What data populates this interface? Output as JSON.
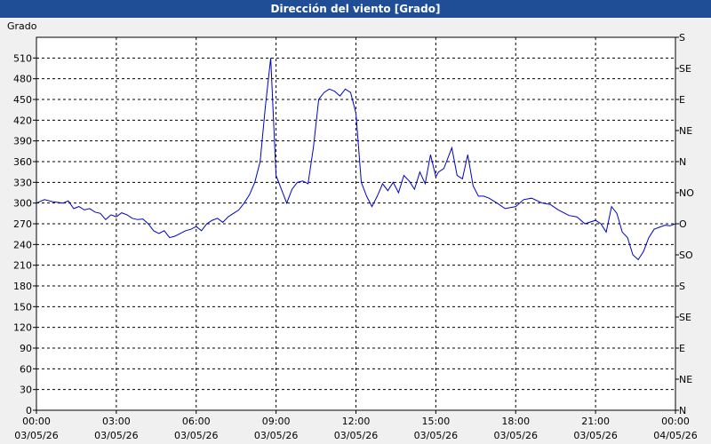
{
  "window": {
    "title": "Dirección del viento [Grado]"
  },
  "chart_data": {
    "type": "line",
    "title": "Dirección del viento [Grado]",
    "ylabel": "Grado",
    "ylim": [
      0,
      540
    ],
    "y_ticks": [
      0,
      30,
      60,
      90,
      120,
      150,
      180,
      210,
      240,
      270,
      300,
      330,
      360,
      390,
      420,
      450,
      480,
      510
    ],
    "right_axis_labels": [
      {
        "value": 0,
        "label": "N"
      },
      {
        "value": 45,
        "label": "NE"
      },
      {
        "value": 90,
        "label": "E"
      },
      {
        "value": 135,
        "label": "SE"
      },
      {
        "value": 180,
        "label": "S"
      },
      {
        "value": 225,
        "label": "SO"
      },
      {
        "value": 270,
        "label": "O"
      },
      {
        "value": 315,
        "label": "NO"
      },
      {
        "value": 360,
        "label": "N"
      },
      {
        "value": 405,
        "label": "NE"
      },
      {
        "value": 450,
        "label": "E"
      },
      {
        "value": 495,
        "label": "SE"
      },
      {
        "value": 540,
        "label": "S"
      }
    ],
    "xlim_hours": [
      0,
      24
    ],
    "x_ticks": [
      {
        "hour": 0,
        "time": "00:00",
        "date": "03/05/26"
      },
      {
        "hour": 3,
        "time": "03:00",
        "date": "03/05/26"
      },
      {
        "hour": 6,
        "time": "06:00",
        "date": "03/05/26"
      },
      {
        "hour": 9,
        "time": "09:00",
        "date": "03/05/26"
      },
      {
        "hour": 12,
        "time": "12:00",
        "date": "03/05/26"
      },
      {
        "hour": 15,
        "time": "15:00",
        "date": "03/05/26"
      },
      {
        "hour": 18,
        "time": "18:00",
        "date": "03/05/26"
      },
      {
        "hour": 21,
        "time": "21:00",
        "date": "03/05/26"
      },
      {
        "hour": 24,
        "time": "00:00",
        "date": "04/05/26"
      }
    ],
    "grid": true,
    "series": [
      {
        "color": "#0000cc",
        "x": [
          0.0,
          0.3,
          0.6,
          1.0,
          1.2,
          1.4,
          1.6,
          1.8,
          2.0,
          2.2,
          2.4,
          2.6,
          2.8,
          3.0,
          3.2,
          3.4,
          3.6,
          3.8,
          4.0,
          4.2,
          4.4,
          4.6,
          4.8,
          5.0,
          5.2,
          5.4,
          5.6,
          5.8,
          6.0,
          6.2,
          6.4,
          6.6,
          6.8,
          7.0,
          7.2,
          7.4,
          7.6,
          7.8,
          8.0,
          8.2,
          8.4,
          8.6,
          8.8,
          9.0,
          9.2,
          9.4,
          9.6,
          9.8,
          10.0,
          10.2,
          10.4,
          10.6,
          10.8,
          11.0,
          11.2,
          11.4,
          11.6,
          11.8,
          12.0,
          12.2,
          12.4,
          12.6,
          12.8,
          13.0,
          13.2,
          13.4,
          13.6,
          13.8,
          14.0,
          14.2,
          14.4,
          14.6,
          14.8,
          15.0,
          15.1,
          15.3,
          15.6,
          15.8,
          16.0,
          16.2,
          16.4,
          16.6,
          16.8,
          17.0,
          17.3,
          17.6,
          18.0,
          18.3,
          18.6,
          19.0,
          19.3,
          19.6,
          20.0,
          20.3,
          20.6,
          21.0,
          21.2,
          21.4,
          21.6,
          21.8,
          22.0,
          22.2,
          22.4,
          22.6,
          22.8,
          23.0,
          23.2,
          23.4,
          23.6,
          23.8,
          24.0
        ],
        "y": [
          300,
          305,
          302,
          300,
          303,
          292,
          295,
          290,
          292,
          287,
          285,
          276,
          283,
          280,
          286,
          283,
          278,
          276,
          277,
          270,
          260,
          256,
          260,
          250,
          252,
          256,
          260,
          262,
          266,
          260,
          270,
          275,
          278,
          272,
          280,
          285,
          290,
          300,
          312,
          330,
          360,
          440,
          510,
          340,
          320,
          300,
          320,
          330,
          332,
          328,
          380,
          450,
          460,
          465,
          462,
          455,
          465,
          460,
          430,
          330,
          310,
          295,
          310,
          328,
          318,
          330,
          315,
          340,
          332,
          320,
          345,
          328,
          370,
          338,
          345,
          350,
          380,
          340,
          335,
          370,
          325,
          310,
          310,
          307,
          300,
          292,
          295,
          305,
          307,
          300,
          298,
          290,
          282,
          280,
          270,
          275,
          270,
          258,
          295,
          285,
          258,
          250,
          225,
          218,
          230,
          250,
          262,
          265,
          268,
          267,
          270
        ]
      }
    ]
  }
}
